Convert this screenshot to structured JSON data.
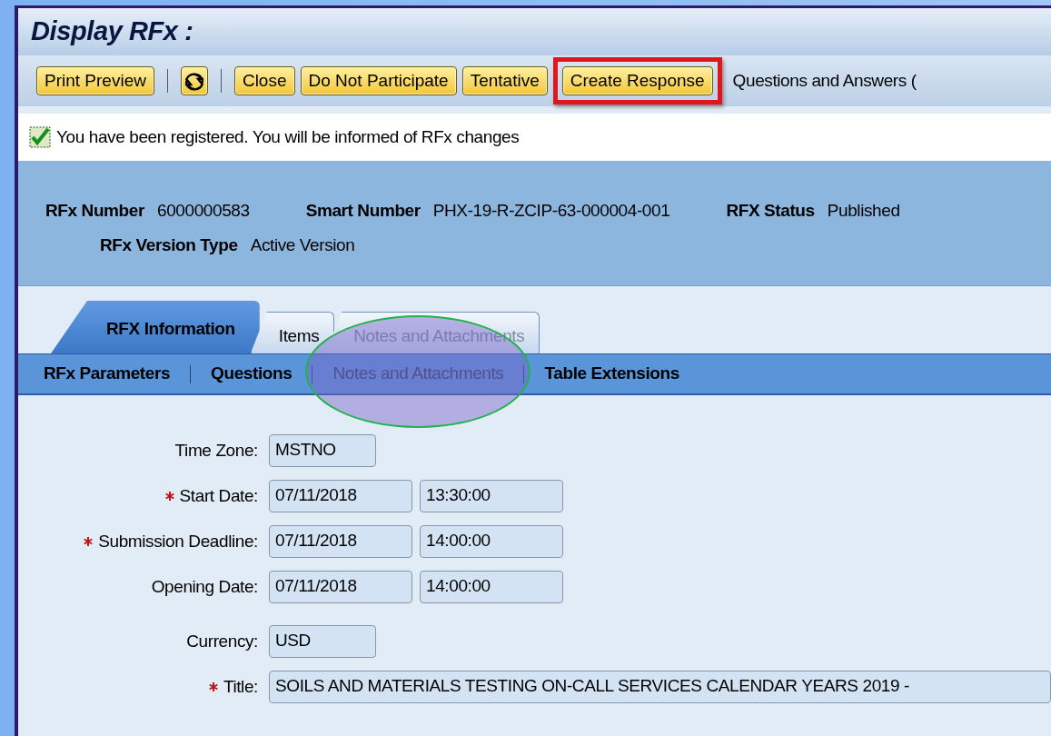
{
  "window": {
    "title": "Display RFx :"
  },
  "toolbar": [
    {
      "kind": "button",
      "label": "Print Preview"
    },
    {
      "kind": "separator"
    },
    {
      "kind": "refresh"
    },
    {
      "kind": "separator"
    },
    {
      "kind": "button",
      "label": "Close"
    },
    {
      "kind": "button",
      "label": "Do Not Participate"
    },
    {
      "kind": "button",
      "label": "Tentative"
    },
    {
      "kind": "button",
      "label": "Create Response",
      "highlighted": true
    },
    {
      "kind": "link",
      "label": "Questions and Answers ("
    }
  ],
  "message": {
    "checked": true,
    "text": "You have been registered. You will be informed of RFx changes"
  },
  "header": [
    [
      {
        "label": "RFx Number",
        "value": "6000000583"
      },
      {
        "label": "Smart Number",
        "value": "PHX-19-R-ZCIP-63-000004-001"
      },
      {
        "label": "RFX Status",
        "value": "Published"
      }
    ],
    [
      {
        "label": "RFx Version Type",
        "value": "Active Version"
      }
    ]
  ],
  "tabs": [
    {
      "label": "RFX Information",
      "selected": true,
      "disabled": false
    },
    {
      "label": "Items",
      "selected": false,
      "disabled": false
    },
    {
      "label": "Notes and Attachments",
      "selected": false,
      "disabled": true
    }
  ],
  "subtabs": [
    {
      "label": "RFx Parameters",
      "disabled": false
    },
    {
      "label": "Questions",
      "disabled": false
    },
    {
      "label": "Notes and Attachments",
      "disabled": true
    },
    {
      "label": "Table Extensions",
      "disabled": false
    }
  ],
  "annotations": [
    {
      "kind": "ellipse"
    }
  ],
  "form": [
    {
      "label": "Time Zone:",
      "required": false,
      "values": [
        "MSTNO"
      ],
      "kind": "short"
    },
    {
      "label": "Start Date:",
      "required": true,
      "values": [
        "07/11/2018",
        "13:30:00"
      ],
      "kind": "date"
    },
    {
      "label": "Submission Deadline:",
      "required": true,
      "values": [
        "07/11/2018",
        "14:00:00"
      ],
      "kind": "date"
    },
    {
      "label": "Opening Date:",
      "required": false,
      "values": [
        "07/11/2018",
        "14:00:00"
      ],
      "kind": "date"
    },
    {
      "label": "Currency:",
      "required": false,
      "values": [
        "USD"
      ],
      "kind": "short"
    },
    {
      "label": "Title:",
      "required": true,
      "values": [
        "SOILS AND MATERIALS TESTING ON-CALL SERVICES CALENDAR YEARS 2019 -"
      ],
      "kind": "long"
    }
  ]
}
